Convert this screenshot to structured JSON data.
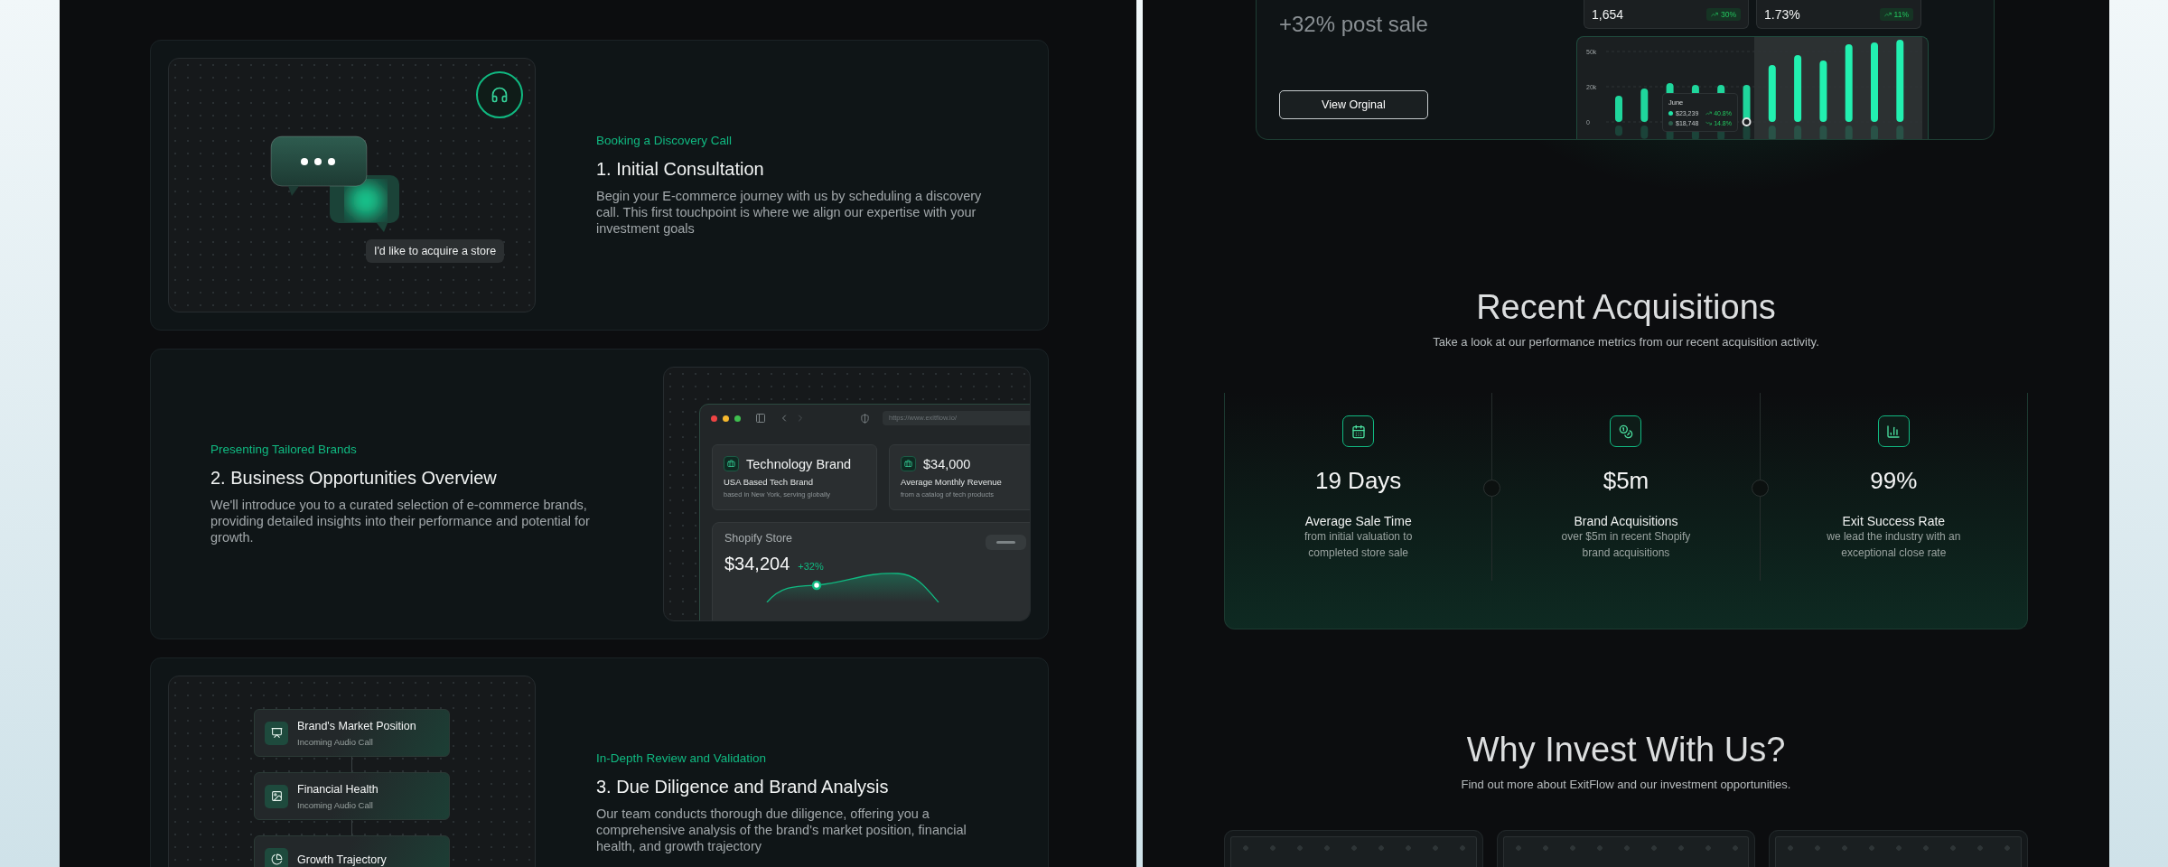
{
  "steps": [
    {
      "kind": "chat",
      "eyebrow": "Booking a Discovery Call",
      "title": "1. Initial Consultation",
      "body": "Begin your E-commerce journey with us by scheduling a discovery call. This first touchpoint is where we align our expertise with your investment goals",
      "chat_message": "I'd like to acquire a store"
    },
    {
      "kind": "browser",
      "eyebrow": "Presenting Tailored Brands",
      "title": "2. Business Opportunities Overview",
      "body": "We'll introduce you to a curated selection of e-commerce brands, providing detailed insights into their performance and potential for growth.",
      "browser": {
        "url": "https://www.exitflow.io/",
        "tiles": [
          {
            "title": "Technology Brand",
            "subtitle": "USA Based Tech Brand",
            "detail": "based in New York, serving globally"
          },
          {
            "title": "$34,000",
            "subtitle": "Average Monthly Revenue",
            "detail": "from a catalog of tech products"
          }
        ],
        "store": {
          "label": "Shopify Store",
          "value": "$34,204",
          "change": "+32%"
        }
      }
    },
    {
      "kind": "flow",
      "eyebrow": "In-Depth Review and Validation",
      "title": "3. Due Diligence and Brand Analysis",
      "body": "Our team conducts thorough due diligence, offering you a comprehensive analysis of the brand's market position, financial health, and growth trajectory",
      "flow": [
        {
          "title": "Brand's Market Position",
          "subtitle": "Incoming Audio Call"
        },
        {
          "title": "Financial Health",
          "subtitle": "Incoming Audio Call"
        },
        {
          "title": "Growth Trajectory"
        }
      ]
    }
  ],
  "showcase": {
    "headline": "+32% post sale",
    "button": "View Orginal",
    "metrics": [
      {
        "value": "1,654",
        "change": "30%"
      },
      {
        "value": "1.73%",
        "change": "11%"
      }
    ],
    "axis_labels": [
      "50k",
      "20k",
      "0"
    ],
    "tooltip": {
      "month": "June",
      "rows": [
        {
          "value": "$23,239",
          "change": "40.8%",
          "color": "#22e3a6"
        },
        {
          "value": "$18,748",
          "change": "14.8%",
          "color": "#2c5b4b"
        }
      ]
    }
  },
  "acquisitions": {
    "title": "Recent Acquisitions",
    "subtitle": "Take a look at our performance metrics from our recent acquisition activity.",
    "stats": [
      {
        "value": "19 Days",
        "label": "Average Sale Time",
        "description": "from initial valuation to completed store sale"
      },
      {
        "value": "$5m",
        "label": "Brand Acquisitions",
        "description": "over $5m in recent Shopify brand acquisitions"
      },
      {
        "value": "99%",
        "label": "Exit Success Rate",
        "description": "we lead the industry with an exceptional close rate"
      }
    ]
  },
  "why_invest": {
    "title": "Why Invest With Us?",
    "subtitle": "Find out more about ExitFlow and our investment opportunities."
  }
}
